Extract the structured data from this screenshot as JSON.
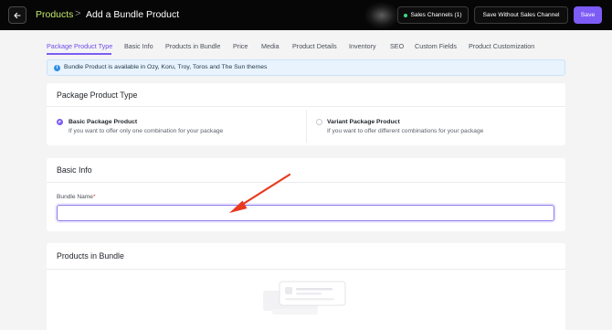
{
  "header": {
    "breadcrumb_root": "Products",
    "separator": ">",
    "title": "Add a Bundle Product",
    "sales_channels_label": "Sales Channels (1)",
    "save_without_label": "Save Without Sales Channel",
    "save_label": "Save",
    "accent_color": "#7c5cf4",
    "breadcrumb_color": "#c5e86c"
  },
  "tabs": [
    {
      "label": "Package Product Type",
      "active": true
    },
    {
      "label": "Basic Info"
    },
    {
      "label": "Products in Bundle"
    },
    {
      "label": "Price"
    },
    {
      "label": "Media"
    },
    {
      "label": "Product Details"
    },
    {
      "label": "Inventory"
    },
    {
      "label": "SEO"
    },
    {
      "label": "Custom Fields"
    },
    {
      "label": "Product Customization"
    }
  ],
  "banner": {
    "icon": "info-icon",
    "text": "Bundle Product is available in Ozy, Koru, Troy, Toros and The Sun themes"
  },
  "package_type": {
    "title": "Package Product Type",
    "options": [
      {
        "label": "Basic Package Product",
        "description": "If you want to offer only one combination for your package",
        "selected": true
      },
      {
        "label": "Variant Package Product",
        "description": "If you want to offer different combinations for your package",
        "selected": false
      }
    ]
  },
  "basic_info": {
    "title": "Basic Info",
    "bundle_name_label": "Bundle Name",
    "required_mark": "*",
    "bundle_name_value": ""
  },
  "products_in_bundle": {
    "title": "Products in Bundle"
  },
  "annotation": {
    "arrow_color": "#e8391f"
  }
}
